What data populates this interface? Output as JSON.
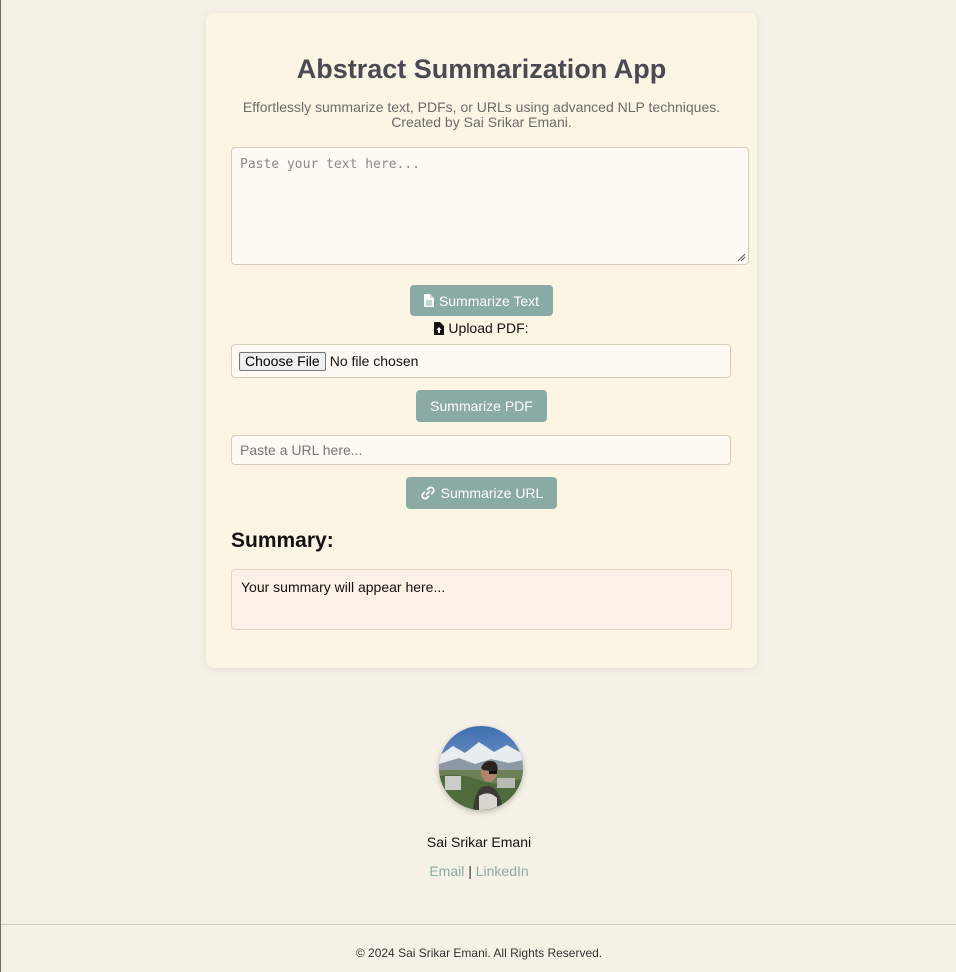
{
  "app": {
    "title": "Abstract Summarization App",
    "subtitle": "Effortlessly summarize text, PDFs, or URLs using advanced NLP techniques. Created by Sai Srikar Emani."
  },
  "text_input": {
    "placeholder": "Paste your text here...",
    "value": ""
  },
  "buttons": {
    "summarize_text": "Summarize Text",
    "summarize_pdf": "Summarize PDF",
    "summarize_url": "Summarize URL"
  },
  "pdf_upload": {
    "label": "Upload PDF:",
    "choose_button": "Choose File",
    "status": "No file chosen"
  },
  "url_input": {
    "placeholder": "Paste a URL here...",
    "value": ""
  },
  "summary": {
    "heading": "Summary:",
    "text": "Your summary will appear here..."
  },
  "profile": {
    "name": "Sai Srikar Emani",
    "email_label": "Email",
    "separator": "|",
    "linkedin_label": "LinkedIn"
  },
  "footer": {
    "copyright": "© 2024 Sai Srikar Emani. All Rights Reserved."
  },
  "colors": {
    "background": "#f6f1e6",
    "card": "#fdf5e3",
    "accent": "#8aaaa5",
    "title": "#4a4a55"
  },
  "icons": {
    "summarize_text": "file-text-icon",
    "upload_pdf": "file-upload-icon",
    "summarize_url": "link-icon"
  }
}
